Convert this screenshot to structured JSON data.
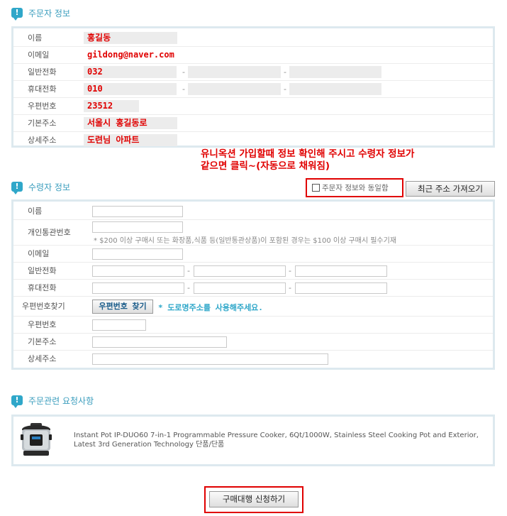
{
  "orderer": {
    "title": "주문자 정보",
    "rows": [
      {
        "label": "이름",
        "value": "홍길동"
      },
      {
        "label": "이메일",
        "value": "gildong@naver.com"
      },
      {
        "label": "일반전화",
        "value": "032"
      },
      {
        "label": "휴대전화",
        "value": "010"
      },
      {
        "label": "우편번호",
        "value": "23512"
      },
      {
        "label": "기본주소",
        "value": "서울시 홍길동로"
      },
      {
        "label": "상세주소",
        "value": "도련님 아파트"
      }
    ]
  },
  "annotation": {
    "line1": "유니옥션 가입할때 정보 확인해 주시고 수령자 정보가",
    "line2": "같으면 클릭~(자동으로 채워짐)"
  },
  "recipient": {
    "title": "수령자 정보",
    "same_as_orderer_label": "주문자 정보와 동일함",
    "recent_address_button": "최근 주소 가져오기",
    "rows": {
      "name": "이름",
      "customs_code": "개인통관번호",
      "customs_note": "* $200 이상 구매시 또는 화장품,식품 등(일반통관상품)이 포함된 경우는 $100 이상 구매시 필수기재",
      "email": "이메일",
      "phone": "일반전화",
      "mobile": "휴대전화",
      "postcode_search": "우편번호찾기",
      "postcode_search_button": "우편번호 찾기",
      "postcode_search_note": "* 도로명주소를 사용해주세요.",
      "postcode": "우편번호",
      "address": "기본주소",
      "address_detail": "상세주소"
    }
  },
  "requests": {
    "title": "주문관련 요청사항",
    "product_description": "Instant Pot IP-DUO60 7-in-1 Programmable Pressure Cooker, 6Qt/1000W, Stainless Steel Cooking Pot and Exterior, Latest 3rd Generation Technology 단품/단품"
  },
  "submit_button": "구매대행 신청하기",
  "colors": {
    "accent": "#3a9dbd",
    "annotation_red": "#e00000",
    "box_border": "#dde9ef"
  }
}
